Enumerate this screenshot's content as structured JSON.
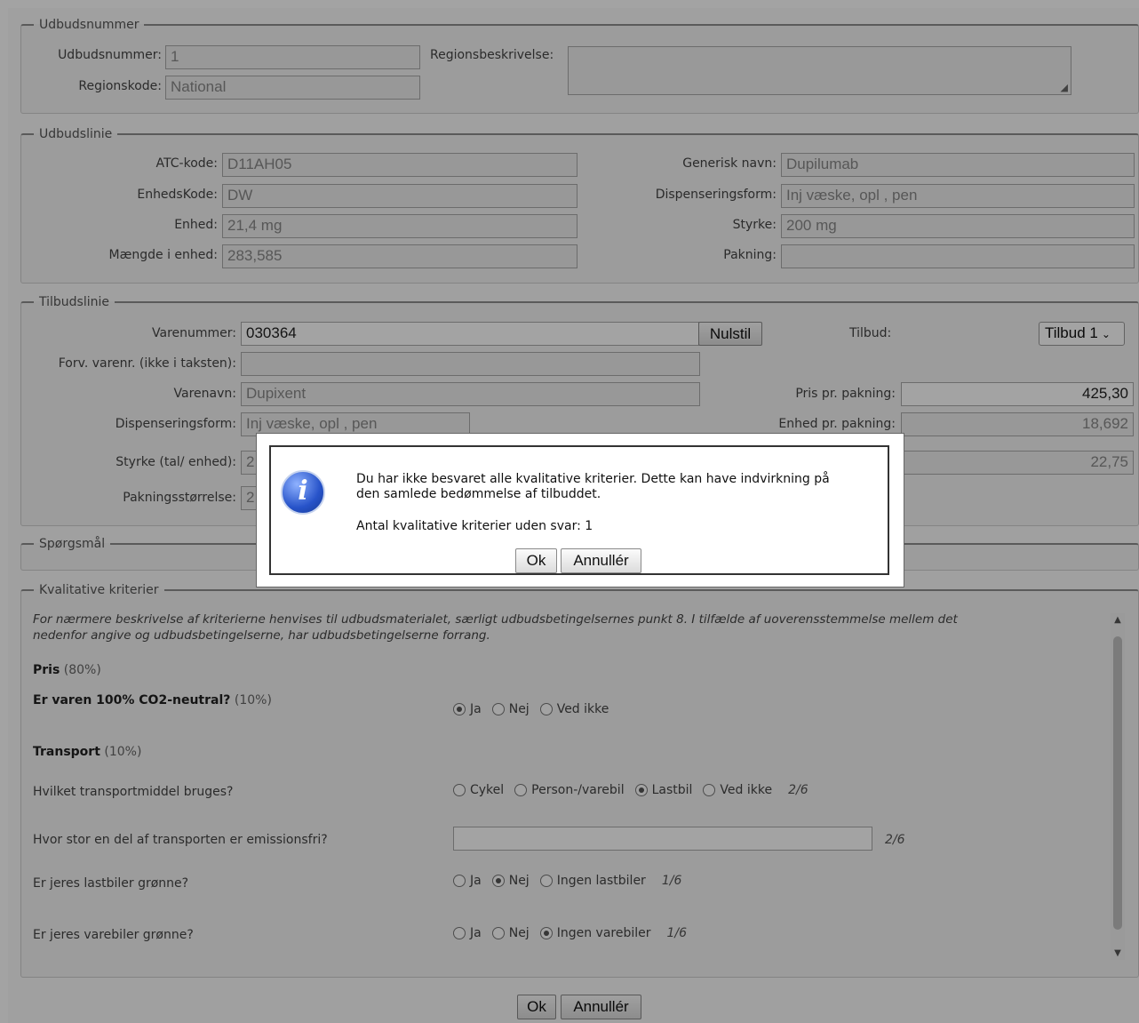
{
  "udbud": {
    "legend": "Udbudsnummer",
    "udbudsnummer_label": "Udbudsnummer:",
    "udbudsnummer_value": "1",
    "regionskode_label": "Regionskode:",
    "regionskode_value": "National",
    "regionsbeskrivelse_label": "Regionsbeskrivelse:"
  },
  "udbudslinie": {
    "legend": "Udbudslinie",
    "atc_label": "ATC-kode:",
    "atc_value": "D11AH05",
    "enhedskode_label": "EnhedsKode:",
    "enhedskode_value": "DW",
    "enhed_label": "Enhed:",
    "enhed_value": "21,4 mg",
    "maengde_label": "Mængde i enhed:",
    "maengde_value": "283,585",
    "generisk_label": "Generisk navn:",
    "generisk_value": "Dupilumab",
    "dispensering_label": "Dispenseringsform:",
    "dispensering_value": "Inj væske, opl , pen",
    "styrke_label": "Styrke:",
    "styrke_value": "200 mg",
    "pakning_label": "Pakning:",
    "pakning_value": ""
  },
  "tilbudslinie": {
    "legend": "Tilbudslinie",
    "varenummer_label": "Varenummer:",
    "varenummer_value": "030364",
    "nulstil_label": "Nulstil",
    "tilbud_label": "Tilbud:",
    "tilbud_selected": "Tilbud 1",
    "forv_label": "Forv. varenr. (ikke i taksten):",
    "forv_value": "",
    "varenavn_label": "Varenavn:",
    "varenavn_value": "Dupixent",
    "dispensering_label": "Dispenseringsform:",
    "dispensering_value": "Inj væske, opl , pen",
    "styrke_label": "Styrke (tal/ enhed):",
    "styrke_value": "2",
    "pakningsstoerrelse_label": "Pakningsstørrelse:",
    "pakningsstoerrelse_value": "2",
    "pris_label": "Pris pr. pakning:",
    "pris_value": "425,30",
    "enhed_pr_label": "Enhed pr. pakning:",
    "enhed_pr_value": "18,692",
    "third_value": "22,75"
  },
  "spoergsmaal": {
    "legend": "Spørgsmål"
  },
  "kvalitative": {
    "legend": "Kvalitative kriterier",
    "note_line1": "For nærmere beskrivelse af kriterierne henvises til udbudsmaterialet, særligt udbudsbetingelsernes punkt 8. I tilfælde af uoverensstemmelse mellem det",
    "note_line2": "nedenfor angive og udbudsbetingelserne, har udbudsbetingelserne forrang.",
    "pris_title": "Pris",
    "pris_pct": "(80%)",
    "co2_title": "Er varen 100% CO2-neutral?",
    "co2_pct": "(10%)",
    "co2_options": [
      "Ja",
      "Nej",
      "Ved ikke"
    ],
    "co2_selected": 0,
    "transport_title": "Transport",
    "transport_pct": "(10%)",
    "q1": "Hvilket transportmiddel bruges?",
    "q1_options": [
      "Cykel",
      "Person-/varebil",
      "Lastbil",
      "Ved ikke"
    ],
    "q1_selected": 2,
    "q1_score": "2/6",
    "q2": "Hvor stor en del af transporten er emissionsfri?",
    "q2_value": "",
    "q2_score": "2/6",
    "q3": "Er jeres lastbiler grønne?",
    "q3_options": [
      "Ja",
      "Nej",
      "Ingen lastbiler"
    ],
    "q3_selected": 1,
    "q3_score": "1/6",
    "q4": "Er jeres varebiler grønne?",
    "q4_options": [
      "Ja",
      "Nej",
      "Ingen varebiler"
    ],
    "q4_selected": 2,
    "q4_score": "1/6"
  },
  "footer": {
    "ok_label": "Ok",
    "cancel_label": "Annullér"
  },
  "dialog": {
    "message_line1": "Du har ikke besvaret alle kvalitative kriterier. Dette kan have indvirkning på",
    "message_line2": "den samlede bedømmelse af tilbuddet.",
    "count_text": "Antal kvalitative kriterier uden svar: 1",
    "ok_label": "Ok",
    "cancel_label": "Annullér",
    "icon": "info-icon"
  }
}
